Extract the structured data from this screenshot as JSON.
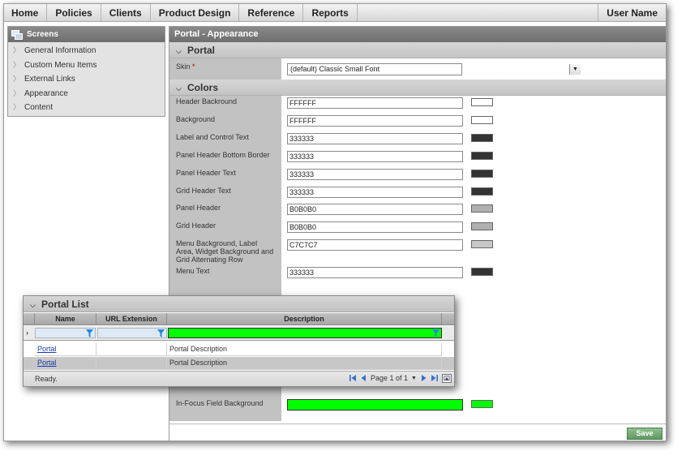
{
  "menu": {
    "items": [
      "Home",
      "Policies",
      "Clients",
      "Product Design",
      "Reference",
      "Reports"
    ],
    "user_name": "User Name"
  },
  "left_panel": {
    "title": "Screens",
    "items": [
      "General Information",
      "Custom Menu Items",
      "External Links",
      "Appearance",
      "Content"
    ]
  },
  "main": {
    "title": "Portal - Appearance",
    "portal_section": "Portal",
    "skin_label": "Skin",
    "skin_required": "*",
    "skin_value": "(default) Classic Small Font",
    "colors_section": "Colors",
    "colors": [
      {
        "label": "Header Backround",
        "value": "FFFFFF",
        "swatch": "#FFFFFF"
      },
      {
        "label": "Background",
        "value": "FFFFFF",
        "swatch": "#FFFFFF"
      },
      {
        "label": "Label and Control Text",
        "value": "333333",
        "swatch": "#333333"
      },
      {
        "label": "Panel Header Bottom Border",
        "value": "333333",
        "swatch": "#333333"
      },
      {
        "label": "Panel Header Text",
        "value": "333333",
        "swatch": "#333333"
      },
      {
        "label": "Grid Header Text",
        "value": "333333",
        "swatch": "#333333"
      },
      {
        "label": "Panel Header",
        "value": "B0B0B0",
        "swatch": "#B0B0B0"
      },
      {
        "label": "Grid Header",
        "value": "B0B0B0",
        "swatch": "#B0B0B0"
      },
      {
        "label": "Menu Background, Label Area, Widget Background and Grid Alternating Row",
        "value": "C7C7C7",
        "swatch": "#C7C7C7"
      },
      {
        "label": "Menu Text",
        "value": "333333",
        "swatch": "#333333"
      }
    ],
    "hidden_swatches": [
      "#333333",
      "#B0B0B0",
      "#333333",
      "#8C8C8C",
      "#333333",
      "#8C8C8C"
    ],
    "in_focus_label": "In-Focus Field Background",
    "in_focus_color": "#00FF00",
    "save_label": "Save"
  },
  "portal_list": {
    "title": "Portal List",
    "columns": [
      "Name",
      "URL Extension",
      "Description"
    ],
    "filter_description_color": "#00FF00",
    "rows": [
      {
        "name": "Portal",
        "url": "",
        "description": "Portal Description"
      },
      {
        "name": "Portal",
        "url": "",
        "description": "Portal Description"
      }
    ],
    "status": "Ready.",
    "pager_text": "Page 1 of 1"
  },
  "colors": {
    "header_gradient_top": "#8a8a8a",
    "header_gradient_bottom": "#6e6e6e",
    "label_area": "#c2c2c2",
    "save_green": "#6fa86f",
    "link_blue": "#1a3aa8",
    "focus_green": "#00FF00"
  }
}
